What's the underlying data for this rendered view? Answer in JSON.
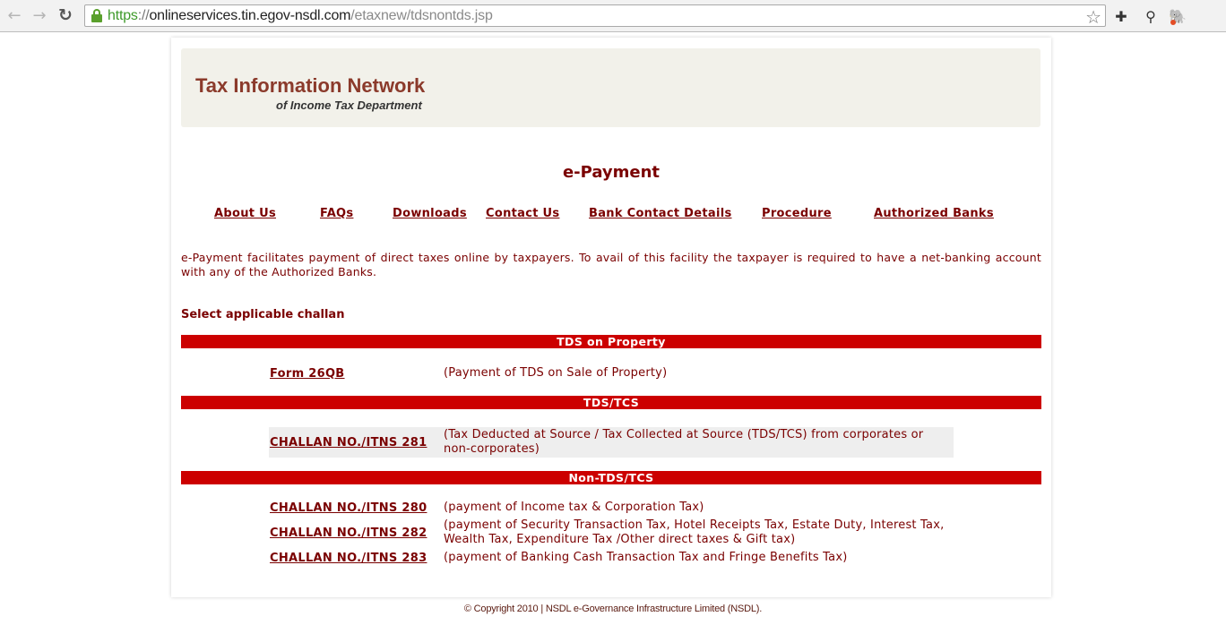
{
  "browser": {
    "url_scheme": "https",
    "url_sep": "://",
    "url_host": "onlineservices.tin.egov-nsdl.com",
    "url_path": "/etaxnew/tdsnontds.jsp",
    "icons": {
      "back": "←",
      "forward": "→",
      "reload": "↻",
      "star": "☆",
      "extension": "✚",
      "lamp": "⚲",
      "elephant": "🐘"
    }
  },
  "banner": {
    "title": "Tax Information Network",
    "subtitle": "of Income Tax Department"
  },
  "page_title": "e-Payment",
  "nav": [
    {
      "label": "About Us"
    },
    {
      "label": "FAQs"
    },
    {
      "label": "Downloads"
    },
    {
      "label": "Contact Us"
    },
    {
      "label": "Bank Contact Details"
    },
    {
      "label": "Procedure"
    },
    {
      "label": "Authorized Banks"
    }
  ],
  "intro": "e-Payment facilitates payment of direct taxes online by taxpayers. To avail of this facility the taxpayer is required to have a net-banking account with any of the Authorized Banks.",
  "select_label": "Select applicable challan",
  "sections": [
    {
      "title": "TDS on Property",
      "items": [
        {
          "link": "Form 26QB",
          "desc": "(Payment of TDS on Sale of Property)"
        }
      ]
    },
    {
      "title": "TDS/TCS",
      "items": [
        {
          "link": "CHALLAN NO./ITNS 281",
          "desc": "(Tax Deducted at Source / Tax Collected at Source (TDS/TCS) from corporates or non-corporates)"
        }
      ]
    },
    {
      "title": "Non-TDS/TCS",
      "items": [
        {
          "link": "CHALLAN NO./ITNS 280",
          "desc": "(payment of Income tax & Corporation Tax)"
        },
        {
          "link": "CHALLAN NO./ITNS 282",
          "desc": "(payment of Security Transaction Tax, Hotel Receipts Tax, Estate Duty, Interest Tax, Wealth Tax, Expenditure Tax /Other direct taxes & Gift tax)"
        },
        {
          "link": "CHALLAN NO./ITNS 283",
          "desc": "(payment of Banking Cash Transaction Tax and Fringe Benefits Tax)"
        }
      ]
    }
  ],
  "footer": "© Copyright 2010 | NSDL e-Governance Infrastructure Limited (NSDL).",
  "colors": {
    "brand_maroon": "#7a0000",
    "section_bar": "#cc0000",
    "banner_bg": "#f2f1ea",
    "banner_title": "#8b3a2b"
  }
}
